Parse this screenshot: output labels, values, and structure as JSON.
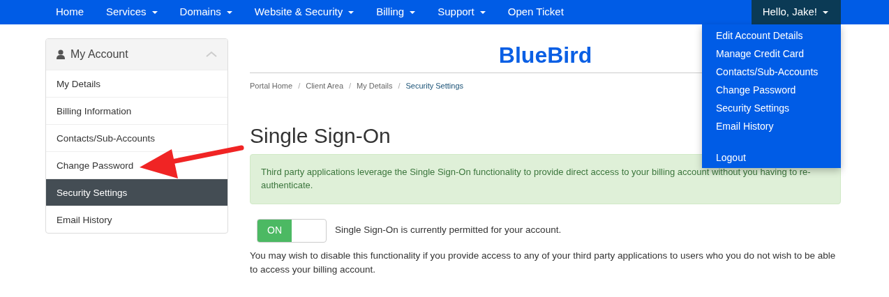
{
  "navbar": {
    "items": [
      {
        "label": "Home",
        "dropdown": false
      },
      {
        "label": "Services",
        "dropdown": true
      },
      {
        "label": "Domains",
        "dropdown": true
      },
      {
        "label": "Website & Security",
        "dropdown": true
      },
      {
        "label": "Billing",
        "dropdown": true
      },
      {
        "label": "Support",
        "dropdown": true
      },
      {
        "label": "Open Ticket",
        "dropdown": false
      }
    ],
    "user": {
      "label": "Hello, Jake!",
      "expanded": true
    }
  },
  "user_menu": {
    "groups": [
      [
        "Edit Account Details",
        "Manage Credit Card",
        "Contacts/Sub-Accounts",
        "Change Password",
        "Security Settings",
        "Email History"
      ],
      [
        "Logout"
      ]
    ]
  },
  "sidebar": {
    "title": "My Account",
    "expanded": true,
    "items": [
      {
        "label": "My Details",
        "selected": false
      },
      {
        "label": "Billing Information",
        "selected": false
      },
      {
        "label": "Contacts/Sub-Accounts",
        "selected": false
      },
      {
        "label": "Change Password",
        "selected": false
      },
      {
        "label": "Security Settings",
        "selected": true
      },
      {
        "label": "Email History",
        "selected": false
      }
    ]
  },
  "logo": "BlueBird",
  "breadcrumb": [
    {
      "label": "Portal Home",
      "selected": false
    },
    {
      "label": "Client Area",
      "selected": false
    },
    {
      "label": "My Details",
      "selected": false
    },
    {
      "label": "Security Settings",
      "selected": true
    }
  ],
  "breadcrumb_separator": "/",
  "heading": "Single Sign-On",
  "alert": "Third party applications leverage the Single Sign-On functionality to provide direct access to your billing account without you having to re-authenticate.",
  "toggle": {
    "on": true,
    "label": "ON",
    "status": "Single Sign-On is currently permitted for your account."
  },
  "note": "You may wish to disable this functionality if you provide access to any of your third party applications to users who you do not wish to be able to access your billing account."
}
